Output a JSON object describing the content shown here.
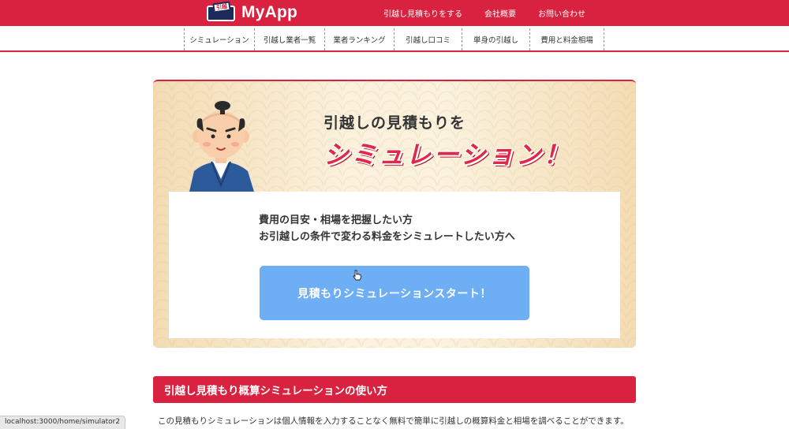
{
  "header": {
    "logo_text": "MyApp",
    "logo_badge_text": "引越",
    "nav": [
      "引越し見積もりをする",
      "会社概要",
      "お問い合わせ"
    ]
  },
  "subnav": {
    "items": [
      "シミュレーション",
      "引越し業者一覧",
      "業者ランキング",
      "引越し口コミ",
      "単身の引越し",
      "費用と料金相場"
    ]
  },
  "hero": {
    "title_line1": "引越しの見積もりを",
    "title_line2": "シミュレーション！",
    "description_line1": "費用の目安・相場を把握したい方",
    "description_line2": "お引越しの条件で変わる料金をシミュレートしたい方へ",
    "start_button": "見積もりシミュレーションスタート！"
  },
  "section": {
    "heading": "引越し見積もり概算シミュレーションの使い方",
    "paragraph": "この見積もりシミュレーションは個人情報を入力することなく無料で簡単に引越しの概算料金と相場を調べることができます。"
  },
  "status_bar": {
    "url": "localhost:3000/home/simulator2"
  },
  "colors": {
    "brand_red": "#d9223f",
    "button_blue": "#6eaef5"
  }
}
